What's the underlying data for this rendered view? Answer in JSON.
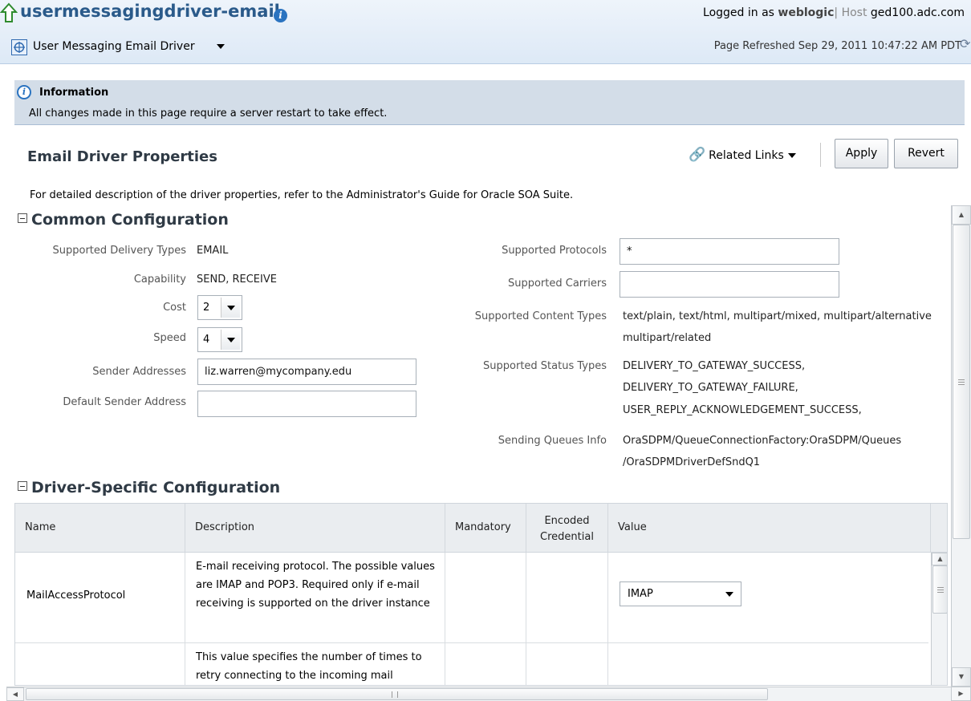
{
  "header": {
    "target_title": "usermessagingdriver-email",
    "target_menu_label": "User Messaging Email Driver",
    "logged_in_prefix": "Logged in as",
    "user": "weblogic",
    "separator": "|",
    "host_prefix": "Host",
    "host": "ged100.adc.com",
    "page_refreshed": "Page Refreshed Sep 29, 2011 10:47:22 AM PDT"
  },
  "info": {
    "title": "Information",
    "message": "All changes made in this page require a server restart to take effect."
  },
  "page": {
    "title": "Email Driver Properties",
    "related_links": "Related Links",
    "apply": "Apply",
    "revert": "Revert",
    "description": "For detailed description of the driver properties, refer to the Administrator's Guide for Oracle SOA Suite."
  },
  "common": {
    "section_title": "Common Configuration",
    "supported_delivery_types_label": "Supported Delivery Types",
    "supported_delivery_types": "EMAIL",
    "capability_label": "Capability",
    "capability": "SEND, RECEIVE",
    "cost_label": "Cost",
    "cost": "2",
    "speed_label": "Speed",
    "speed": "4",
    "sender_addresses_label": "Sender Addresses",
    "sender_addresses": "liz.warren@mycompany.edu",
    "default_sender_label": "Default Sender Address",
    "default_sender": "",
    "protocols_label": "Supported Protocols",
    "protocols": "*",
    "carriers_label": "Supported Carriers",
    "carriers": "",
    "content_types_label": "Supported Content Types",
    "content_types_line1": "text/plain, text/html, multipart/mixed, multipart/alternative",
    "content_types_line2": "multipart/related",
    "status_types_label": "Supported Status Types",
    "status_line1": "DELIVERY_TO_GATEWAY_SUCCESS,",
    "status_line2": "DELIVERY_TO_GATEWAY_FAILURE,",
    "status_line3": "USER_REPLY_ACKNOWLEDGEMENT_SUCCESS,",
    "queues_label": "Sending Queues Info",
    "queues_line1": "OraSDPM/QueueConnectionFactory:OraSDPM/Queues",
    "queues_line2": "/OraSDPMDriverDefSndQ1"
  },
  "driver_specific": {
    "section_title": "Driver-Specific Configuration",
    "columns": {
      "name": "Name",
      "description": "Description",
      "mandatory": "Mandatory",
      "encoded_1": "Encoded",
      "encoded_2": "Credential",
      "value": "Value"
    },
    "rows": [
      {
        "name": "MailAccessProtocol",
        "description": "E-mail receiving protocol. The possible values are IMAP and POP3. Required only if e-mail receiving is supported on the driver instance",
        "value": "IMAP"
      },
      {
        "name": "",
        "description": "This value specifies the number of times to retry connecting to the incoming mail",
        "value": ""
      }
    ]
  }
}
